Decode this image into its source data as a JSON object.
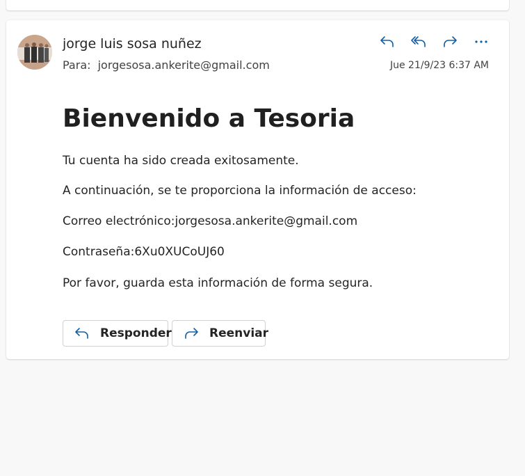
{
  "email": {
    "sender_name": "jorge luis sosa nuñez",
    "to_label": "Para:",
    "to_address": "jorgesosa.ankerite@gmail.com",
    "date": "Jue 21/9/23 6:37 AM"
  },
  "header_actions": [
    {
      "icon": "reply-icon"
    },
    {
      "icon": "reply-all-icon"
    },
    {
      "icon": "forward-icon"
    },
    {
      "icon": "more-icon"
    }
  ],
  "body": {
    "title": "Bienvenido a Tesoria",
    "paragraphs": [
      "Tu cuenta ha sido creada exitosamente.",
      "A continuación, se te proporciona la información de acceso:",
      "Correo electrónico:jorgesosa.ankerite@gmail.com",
      "Contraseña:6Xu0XUCoUJ60",
      "Por favor, guarda esta información de forma segura."
    ]
  },
  "footer_buttons": {
    "reply_label": "Responder",
    "forward_label": "Reenviar"
  },
  "colors": {
    "accent": "#115ea3",
    "background": "#f8f8f8",
    "card": "#ffffff"
  }
}
